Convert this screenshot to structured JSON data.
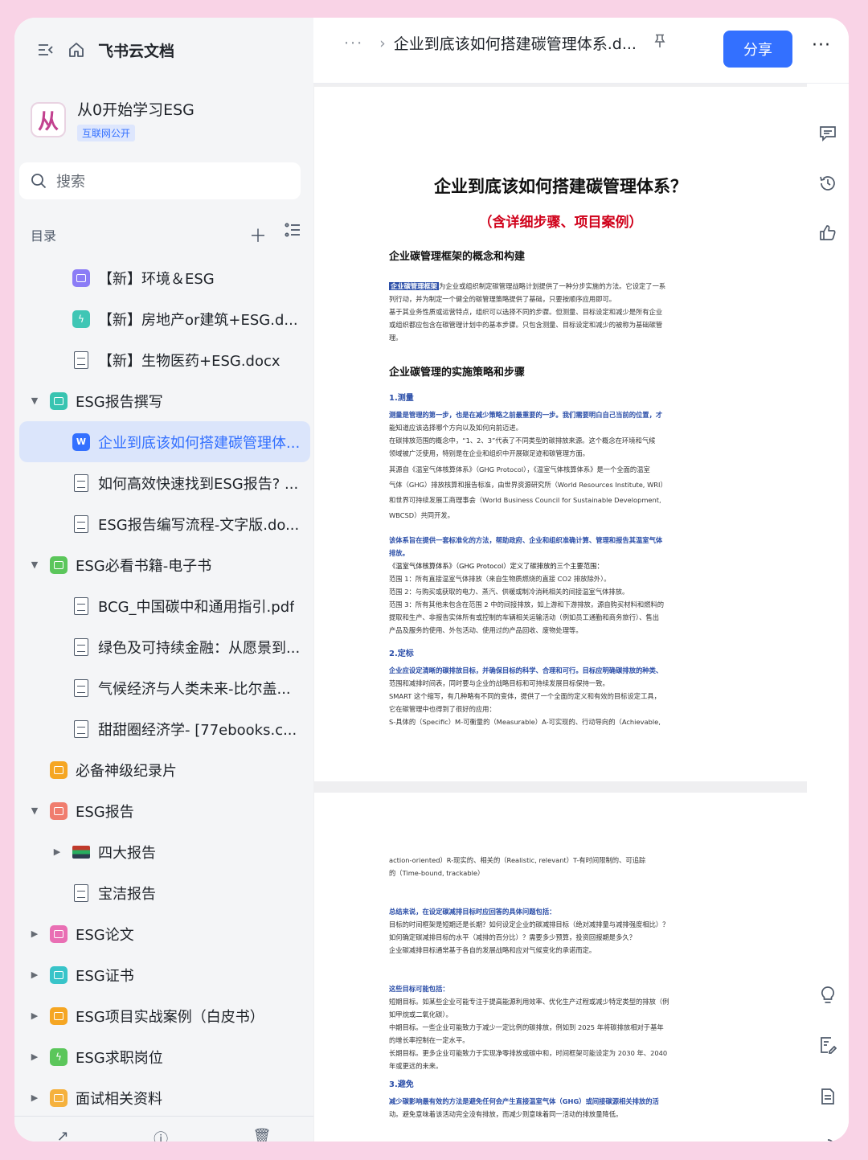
{
  "app": {
    "brand": "飞书云文档"
  },
  "space": {
    "logo_text": "从",
    "title": "从0开始学习ESG",
    "badge": "互联网公开"
  },
  "search": {
    "label": "搜索"
  },
  "toc": {
    "header": "目录",
    "items": [
      {
        "label": "【新】环境＆ESG",
        "level": 2,
        "icon": "purple-doc-icon",
        "color": "#8b7cf6"
      },
      {
        "label": "【新】房地产or建筑+ESG.d...",
        "level": 2,
        "icon": "lightning-icon",
        "color": "#3fc6b5"
      },
      {
        "label": "【新】生物医药+ESG.docx",
        "level": 2,
        "icon": "word-file-icon"
      },
      {
        "label": "ESG报告撰写",
        "level": 1,
        "icon": "teal-folder-icon",
        "color": "#38c4b1",
        "expanded": true
      },
      {
        "label": "企业到底该如何搭建碳管理体...",
        "level": 2,
        "icon": "word-doc-icon",
        "color": "#3370ff",
        "active": true
      },
      {
        "label": "如何高效快速找到ESG报告? ...",
        "level": 2,
        "icon": "pdf-file-icon"
      },
      {
        "label": "ESG报告编写流程-文字版.do...",
        "level": 2,
        "icon": "word-file-icon"
      },
      {
        "label": "ESG必看书籍-电子书",
        "level": 1,
        "icon": "green-folder-icon",
        "color": "#5bc65b",
        "expanded": true
      },
      {
        "label": "BCG_中国碳中和通用指引.pdf",
        "level": 2,
        "icon": "pdf-file-icon"
      },
      {
        "label": "绿色及可持续金融：从愿景到...",
        "level": 2,
        "icon": "pdf-file-icon"
      },
      {
        "label": "气候经济与人类未来-比尔盖...",
        "level": 2,
        "icon": "pdf-file-icon"
      },
      {
        "label": "甜甜圈经济学- [77ebooks.c...",
        "level": 2,
        "icon": "pdf-file-icon"
      },
      {
        "label": "必备神级纪录片",
        "level": 1,
        "icon": "orange-folder-icon",
        "color": "#f5a623"
      },
      {
        "label": "ESG报告",
        "level": 1,
        "icon": "red-folder-icon",
        "color": "#f07d6e",
        "expanded": true
      },
      {
        "label": "四大报告",
        "level": 2,
        "icon": "books-icon",
        "collapsed": true
      },
      {
        "label": "宝洁报告",
        "level": 2,
        "icon": "doc-file-icon"
      },
      {
        "label": "ESG论文",
        "level": 1,
        "icon": "pink-folder-icon",
        "color": "#e96fb4",
        "collapsed": true
      },
      {
        "label": "ESG证书",
        "level": 1,
        "icon": "cyan-folder-icon",
        "color": "#38c4c9",
        "collapsed": true
      },
      {
        "label": "ESG项目实战案例（白皮书）",
        "level": 1,
        "icon": "orange-folder-icon",
        "color": "#f5a623",
        "collapsed": true
      },
      {
        "label": "ESG求职岗位",
        "level": 1,
        "icon": "lightning-folder-icon",
        "color": "#5bc65b",
        "collapsed": true
      },
      {
        "label": "面试相关资料",
        "level": 1,
        "icon": "yellow-folder-icon",
        "color": "#f5b13d",
        "collapsed": true
      }
    ]
  },
  "topbar": {
    "dots": "···",
    "breadcrumb": "企业到底该如何搭建碳管理体系.d...",
    "share_label": "分享",
    "more": "···"
  },
  "doc": {
    "title": "企业到底该如何搭建碳管理体系？",
    "subtitle": "（含详细步骤、项目案例）",
    "h_concept": "企业碳管理框架的概念和构建",
    "highlight": "企业碳管理框架",
    "p1_line1": "为企业或组织制定碳管理战略计划提供了一种分步实施的方法。它设定了一系",
    "p1_line2": "列行动，并为制定一个健全的碳管理策略提供了基础，只要按顺序应用即可。",
    "p1_line3": "基于其业务性质或运营特点，组织可以选择不同的步骤。但测量、目标设定和减少是所有企业",
    "p1_line4": "或组织都应包含在碳管理计划中的基本步骤。只包含测量、目标设定和减少的被称为基础碳管",
    "p1_line5": "理。",
    "h_steps": "企业碳管理的实施策略和步骤",
    "s1": "1.测量",
    "m_line1": "测量是管理的第一步，也是在减少策略之前最重要的一步。我们需要明白自己当前的位置，才",
    "m_line2": "能知道应该选择哪个方向以及如何向前迈进。",
    "m_line3": "在碳排放范围的概念中，“1、2、3”代表了不同类型的碳排放来源。这个概念在环境和气候",
    "m_line4": "领域被广泛使用，特别是在企业和组织中开展碳足迹和碳管理方面。",
    "m_line5": "其源自《温室气体核算体系》（GHG Protocol），《温室气体核算体系》是一个全面的温室",
    "m_line6": "气体（GHG）排放核算和报告标准，由世界资源研究所（World Resources Institute, WRI）",
    "m_line7": "和世界可持续发展工商理事会（World Business Council for Sustainable Development,",
    "m_line8": "WBCSD）共同开发。",
    "g_line1": "该体系旨在提供一套标准化的方法，帮助政府、企业和组织准确计算、管理和报告其温室气体",
    "g_line2": "排放。",
    "g_line3": "《温室气体核算体系》（GHG Protocol）定义了碳排放的三个主要范围：",
    "g_line4": "范围 1：所有直接温室气体排放（来自生物质燃烧的直接 CO2 排放除外）。",
    "g_line5": "范围 2：与购买或获取的电力、蒸汽、供暖或制冷消耗相关的间接温室气体排放。",
    "g_line6": "范围 3：所有其他未包含在范围 2 中的间接排放，如上游和下游排放，源自购买材料和燃料的",
    "g_line7": "提取和生产、非报告实体所有或控制的车辆相关运输活动（例如员工通勤和商务旅行）、售出",
    "g_line8": "产品及服务的使用、外包活动、使用过的产品回收、废物处理等。",
    "s2": "2.定标",
    "t_line1": "企业应设定清晰的碳排放目标，并确保目标的科学、合理和可行。目标应明确碳排放的种类、",
    "t_line2": "范围和减排时间表，同时要与企业的战略目标和可持续发展目标保持一致。",
    "t_line3": "SMART 这个缩写，有几种略有不同的变体，提供了一个全面的定义和有效的目标设定工具，",
    "t_line4": "它在碳管理中也得到了很好的应用：",
    "t_line5": "S-具体的（Specific）M-可衡量的（Measurable）A-可实现的、行动导向的（Achievable,",
    "c_line1": "action-oriented）R-现实的、相关的（Realistic, relevant）T-有时间限制的、可追踪",
    "c_line2": "的（Time-bound, trackable）",
    "q_line1": "总结来说，在设定碳减排目标时应回答的具体问题包括：",
    "q_line2": "目标的时间框架是短期还是长期？如何设定企业的碳减排目标（绝对减排量与减排强度相比）？",
    "q_line3": "如何确定碳减排目标的水平（减排的百分比）？需要多少预算，投资回报期是多久？",
    "q_line4": "企业碳减排目标通常基于各自的发展战略和应对气候变化的承诺而定。",
    "k_line1": "这些目标可能包括：",
    "k_line2": "短期目标。如某些企业可能专注于提高能源利用效率、优化生产过程或减少特定类型的排放（例",
    "k_line3": "如甲烷或二氧化碳）。",
    "k_line4": "中期目标。一些企业可能致力于减少一定比例的碳排放，例如到 2025 年将碳排放相对于基年",
    "k_line5": "的增长率控制在一定水平。",
    "k_line6": "长期目标。更多企业可能致力于实现净零排放或碳中和，时间框架可能设定为 2030 年、2040",
    "k_line7": "年或更远的未来。",
    "s3": "3.避免",
    "a_line1": "减少碳影响最有效的方法是避免任何会产生直接温室气体（GHG）或间接碳源相关排放的活",
    "a_line2": "动。避免意味着该活动完全没有排放，而减少则意味着同一活动的排放量降低。"
  },
  "rail": [
    "comment-icon",
    "history-icon",
    "like-icon",
    "lightbulb-icon",
    "edit-doc-icon",
    "outline-icon",
    "help-icon"
  ]
}
